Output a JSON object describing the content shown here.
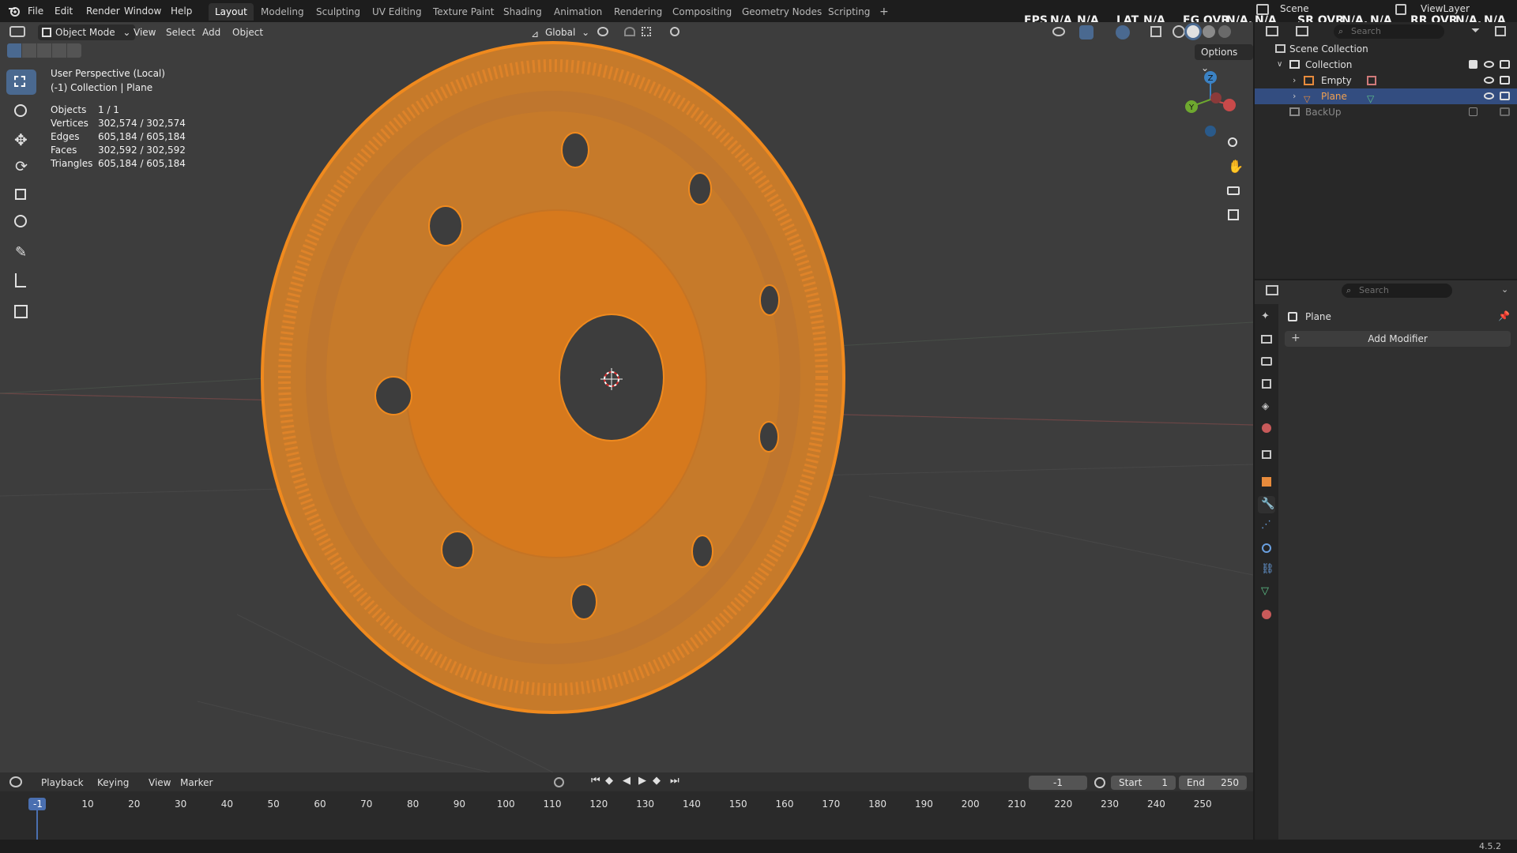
{
  "menu": [
    "File",
    "Edit",
    "Render",
    "Window",
    "Help"
  ],
  "workspaces": [
    "Layout",
    "Modeling",
    "Sculpting",
    "UV Editing",
    "Texture Paint",
    "Shading",
    "Animation",
    "Rendering",
    "Compositing",
    "Geometry Nodes",
    "Scripting"
  ],
  "active_workspace": "Layout",
  "add_tab": "+",
  "top_right": {
    "scene": "Scene",
    "view_layer": "ViewLayer",
    "overlay_stats": [
      {
        "label": "FPS",
        "value": "N/A",
        "value2": "N/A"
      },
      {
        "label": "LAT",
        "value": "N/A",
        "value2": ""
      },
      {
        "label": "FG OVR",
        "value": "N/A,",
        "value2": "N/A"
      },
      {
        "label": "SR OVR",
        "value": "N/A,",
        "value2": "N/A"
      },
      {
        "label": "RR OVR",
        "value": "N/A,",
        "value2": "N/A"
      }
    ]
  },
  "viewport": {
    "mode": "Object Mode",
    "menus": [
      "View",
      "Select",
      "Add",
      "Object"
    ],
    "orientation": "Global",
    "options": "Options",
    "view_name": "User Perspective (Local)",
    "context": "(-1) Collection | Plane",
    "stats": [
      {
        "label": "Objects",
        "value": "1 / 1"
      },
      {
        "label": "Vertices",
        "value": "302,574 / 302,574"
      },
      {
        "label": "Edges",
        "value": "605,184 / 605,184"
      },
      {
        "label": "Faces",
        "value": "302,592 / 302,592"
      },
      {
        "label": "Triangles",
        "value": "605,184 / 605,184"
      }
    ],
    "gizmo": {
      "z": "Z",
      "y": "Y"
    },
    "colors": {
      "mesh": "#f08a1e",
      "mesh_dark": "#c96c10",
      "bg": "#3d3d3d",
      "active": "#4a6990"
    }
  },
  "timeline": {
    "menus": [
      "Playback",
      "Keying",
      "View",
      "Marker"
    ],
    "current_frame": "-1",
    "start_label": "Start",
    "start": "1",
    "end_label": "End",
    "end": "250",
    "frames": [
      "-1",
      "10",
      "20",
      "30",
      "40",
      "50",
      "60",
      "70",
      "80",
      "90",
      "100",
      "110",
      "120",
      "130",
      "140",
      "150",
      "160",
      "170",
      "180",
      "190",
      "200",
      "210",
      "220",
      "230",
      "240",
      "250"
    ]
  },
  "outliner": {
    "search_placeholder": "Search",
    "items": [
      {
        "name": "Scene Collection",
        "icon": "scene-collection-icon"
      },
      {
        "name": "Collection",
        "icon": "collection-icon"
      },
      {
        "name": "Empty",
        "icon": "empty-icon"
      },
      {
        "name": "Plane",
        "icon": "mesh-icon",
        "selected": true
      },
      {
        "name": "BackUp",
        "icon": "collection-icon",
        "dim": true
      }
    ]
  },
  "properties": {
    "search_placeholder": "Search",
    "object_name": "Plane",
    "add_modifier": "Add Modifier",
    "add_glyph": "+"
  },
  "status": {
    "version": "4.5.2"
  }
}
